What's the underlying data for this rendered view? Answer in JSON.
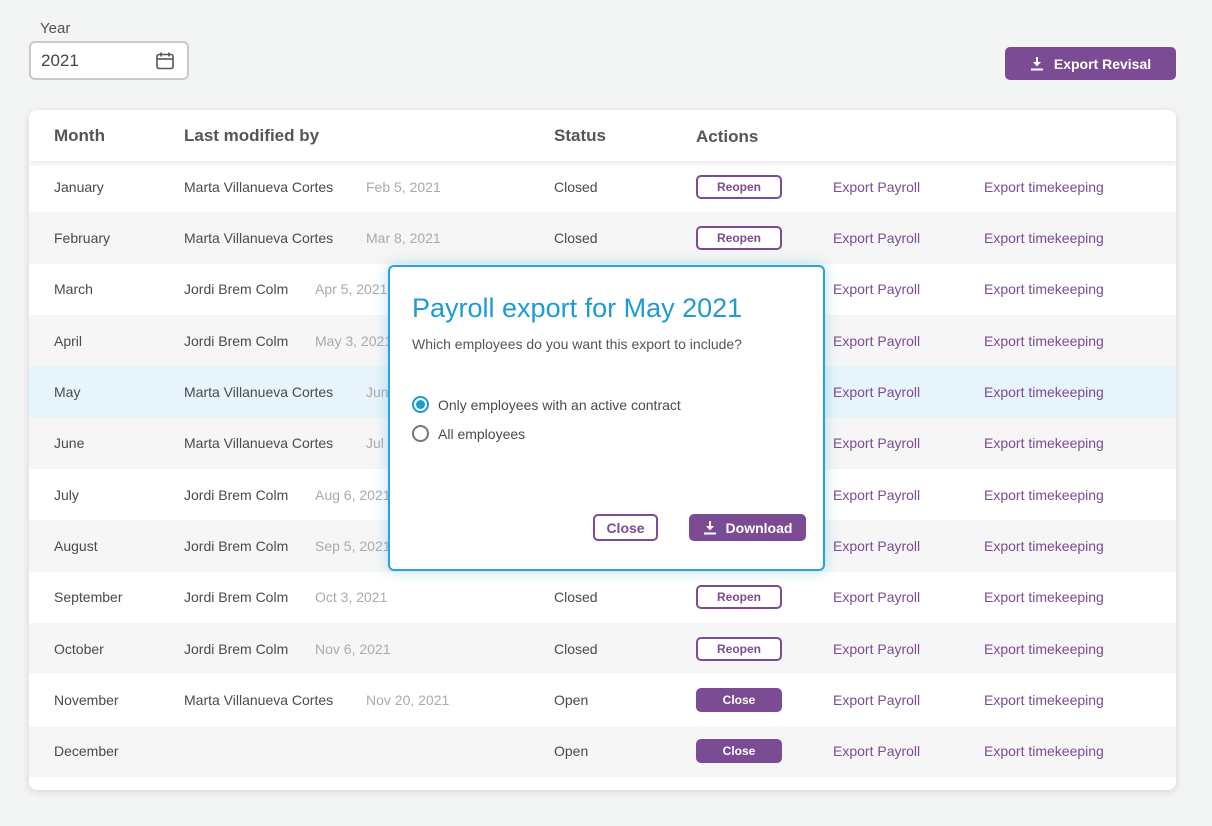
{
  "year_picker": {
    "label": "Year",
    "value": "2021",
    "icon": "calendar-icon"
  },
  "export_revisal": {
    "label": "Export Revisal",
    "icon": "download-icon"
  },
  "table": {
    "headers": {
      "month": "Month",
      "modified_by": "Last modified by",
      "status": "Status",
      "actions": "Actions"
    },
    "rows": [
      {
        "month": "January",
        "user": "Marta Villanueva Cortes",
        "date": "Feb 5, 2021",
        "status": "Closed",
        "action": "Reopen",
        "export_payroll": "Export Payroll",
        "export_timekeeping": "Export timekeeping"
      },
      {
        "month": "February",
        "user": "Marta Villanueva Cortes",
        "date": "Mar 8, 2021",
        "status": "Closed",
        "action": "Reopen",
        "export_payroll": "Export Payroll",
        "export_timekeeping": "Export timekeeping"
      },
      {
        "month": "March",
        "user": "Jordi Brem Colm",
        "date": "Apr 5, 2021",
        "status": "",
        "action": "",
        "export_payroll": "Export Payroll",
        "export_timekeeping": "Export timekeeping"
      },
      {
        "month": "April",
        "user": "Jordi Brem Colm",
        "date": "May 3, 2021",
        "status": "",
        "action": "",
        "export_payroll": "Export Payroll",
        "export_timekeeping": "Export timekeeping"
      },
      {
        "month": "May",
        "user": "Marta Villanueva Cortes",
        "date": "Jun",
        "status": "",
        "action": "",
        "export_payroll": "Export Payroll",
        "export_timekeeping": "Export timekeeping"
      },
      {
        "month": "June",
        "user": "Marta Villanueva Cortes",
        "date": "Jul",
        "status": "",
        "action": "",
        "export_payroll": "Export Payroll",
        "export_timekeeping": "Export timekeeping"
      },
      {
        "month": "July",
        "user": "Jordi Brem Colm",
        "date": "Aug 6, 2021",
        "status": "",
        "action": "",
        "export_payroll": "Export Payroll",
        "export_timekeeping": "Export timekeeping"
      },
      {
        "month": "August",
        "user": "Jordi Brem Colm",
        "date": "Sep 5, 2021",
        "status": "",
        "action": "",
        "export_payroll": "Export Payroll",
        "export_timekeeping": "Export timekeeping"
      },
      {
        "month": "September",
        "user": "Jordi Brem Colm",
        "date": "Oct 3, 2021",
        "status": "Closed",
        "action": "Reopen",
        "export_payroll": "Export Payroll",
        "export_timekeeping": "Export timekeeping"
      },
      {
        "month": "October",
        "user": "Jordi Brem Colm",
        "date": "Nov 6, 2021",
        "status": "Closed",
        "action": "Reopen",
        "export_payroll": "Export Payroll",
        "export_timekeeping": "Export timekeeping"
      },
      {
        "month": "November",
        "user": "Marta Villanueva Cortes",
        "date": "Nov 20, 2021",
        "status": "Open",
        "action": "Close",
        "export_payroll": "Export Payroll",
        "export_timekeeping": "Export timekeeping"
      },
      {
        "month": "December",
        "user": "",
        "date": "",
        "status": "Open",
        "action": "Close",
        "export_payroll": "Export Payroll",
        "export_timekeeping": "Export timekeeping"
      }
    ]
  },
  "modal": {
    "title": "Payroll export for May 2021",
    "subtitle": "Which employees do you want this export to include?",
    "options": [
      {
        "label": "Only employees with an active contract",
        "selected": true
      },
      {
        "label": "All employees",
        "selected": false
      }
    ],
    "close_label": "Close",
    "download_label": "Download"
  },
  "colors": {
    "accent": "#7b4b94",
    "modal_blue": "#1e9bd4",
    "selected_row": "#e8f4fb"
  }
}
